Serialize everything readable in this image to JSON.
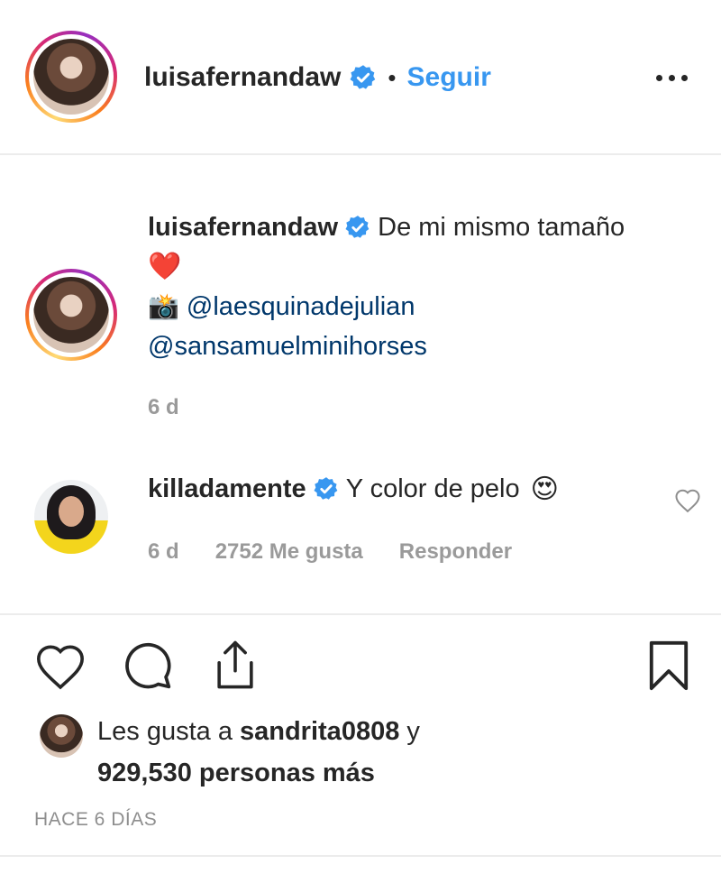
{
  "header": {
    "username": "luisafernandaw",
    "dot": "•",
    "follow_label": "Seguir",
    "more_label": "•••"
  },
  "caption": {
    "username": "luisafernandaw",
    "text": "De mi mismo tamaño",
    "heart": "❤️",
    "camera": "📸",
    "mention1": "@laesquinadejulian",
    "mention2": "@sansamuelminihorses",
    "time": "6 d"
  },
  "comment": {
    "username": "killadamente",
    "text": "Y color de pelo",
    "emoji": "😍",
    "time": "6 d",
    "likes": "2752 Me gusta",
    "reply_label": "Responder"
  },
  "likes": {
    "prefix": "Les gusta a ",
    "user": "sandrita0808",
    "suffix": " y",
    "count_line": "929,530 personas más"
  },
  "timestamp": "HACE 6 DÍAS",
  "colors": {
    "accent": "#3897f0",
    "mention": "#00376b",
    "verified": "#3897f0",
    "muted": "#9a9a9a"
  }
}
